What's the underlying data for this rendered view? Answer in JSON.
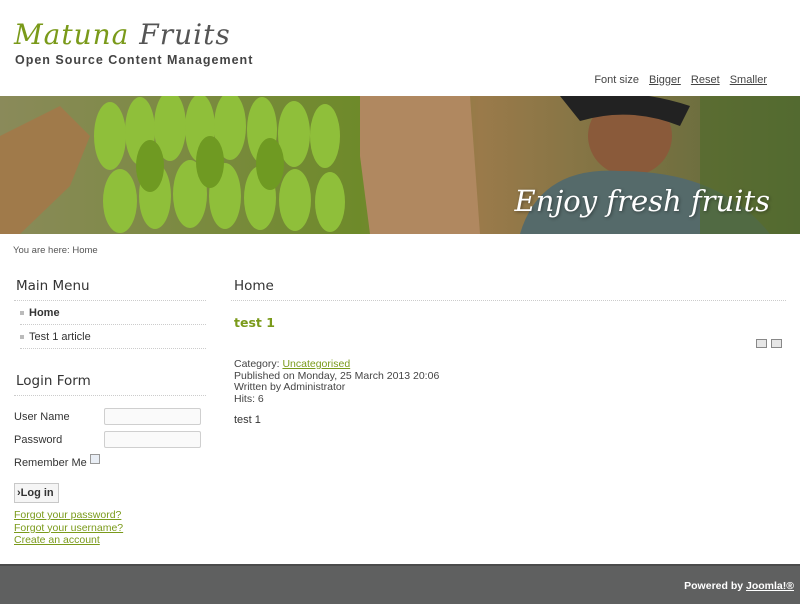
{
  "header": {
    "logo_part1": "Matuna",
    "logo_part2": "Fruits",
    "tagline": "Open Source Content Management"
  },
  "font_size": {
    "label": "Font size",
    "bigger": "Bigger",
    "reset": "Reset",
    "smaller": "Smaller"
  },
  "banner": {
    "text": "Enjoy fresh fruits"
  },
  "breadcrumb": "You are here: Home",
  "main_menu": {
    "title": "Main Menu",
    "items": [
      {
        "label": "Home",
        "active": true
      },
      {
        "label": "Test 1 article",
        "active": false
      }
    ]
  },
  "login_form": {
    "title": "Login Form",
    "username_label": "User Name",
    "username_value": "",
    "password_label": "Password",
    "password_value": "",
    "remember_label": "Remember Me",
    "remember_checked": false,
    "submit_label": "›Log in",
    "links": {
      "forgot_password": "Forgot your password?",
      "forgot_username": "Forgot your username?",
      "create_account": "Create an account"
    }
  },
  "article": {
    "page_heading": "Home",
    "title": "test 1",
    "icons": [
      "print-icon",
      "email-icon"
    ],
    "category_label": "Category:",
    "category_value": "Uncategorised",
    "published": "Published on Monday, 25 March 2013 20:06",
    "written_by": "Written by Administrator",
    "hits": "Hits: 6",
    "body": "test 1"
  },
  "footer": {
    "powered_by": "Powered by",
    "joomla": "Joomla!®"
  },
  "colors": {
    "accent": "#7a9a1a",
    "footer_bg": "#5f6060"
  }
}
